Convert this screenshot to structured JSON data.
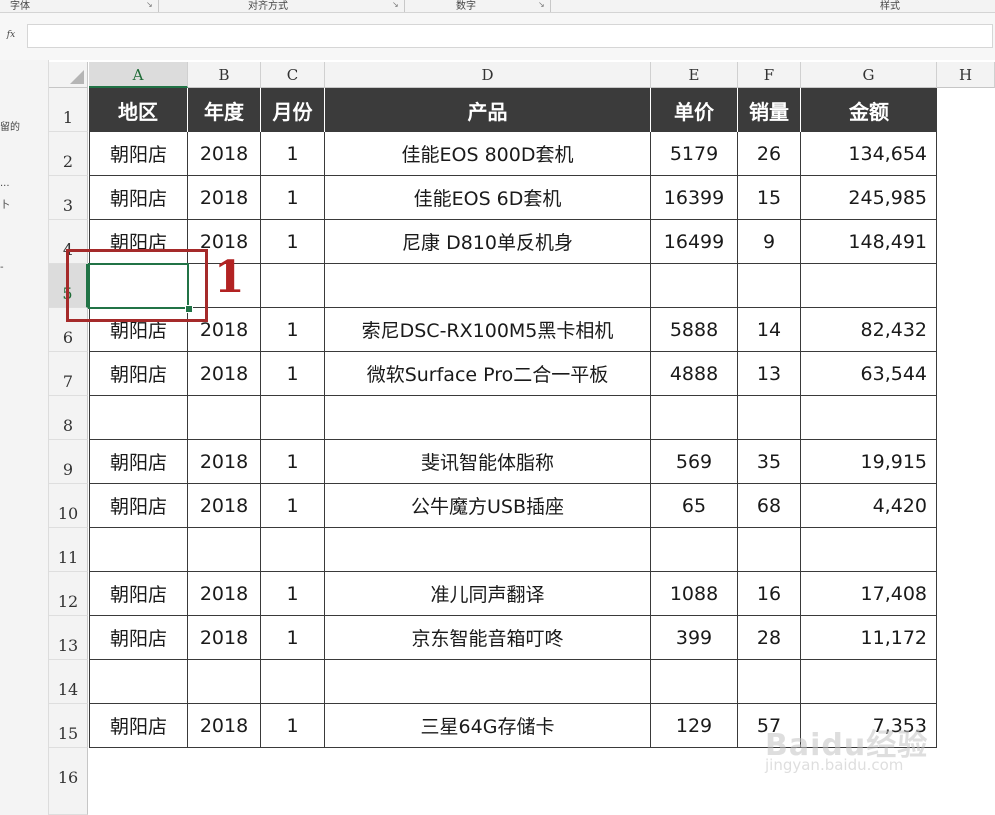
{
  "ribbon": {
    "groups": [
      {
        "label": "字体"
      },
      {
        "label": "对齐方式"
      },
      {
        "label": "数字"
      },
      {
        "label": "样式"
      }
    ]
  },
  "formula_bar": {
    "fx_label": "fx",
    "value": ""
  },
  "left_pane": {
    "texts": [
      "留的",
      "...",
      "卜",
      "-"
    ]
  },
  "columns": [
    "A",
    "B",
    "C",
    "D",
    "E",
    "F",
    "G",
    "H"
  ],
  "active_column": "A",
  "rows": [
    "1",
    "2",
    "3",
    "4",
    "5",
    "6",
    "7",
    "8",
    "9",
    "10",
    "11",
    "12",
    "13",
    "14",
    "15",
    "16"
  ],
  "active_row": "5",
  "table": {
    "headers": [
      "地区",
      "年度",
      "月份",
      "产品",
      "单价",
      "销量",
      "金额"
    ],
    "rows": [
      [
        "朝阳店",
        "2018",
        "1",
        "佳能EOS 800D套机",
        "5179",
        "26",
        "134,654"
      ],
      [
        "朝阳店",
        "2018",
        "1",
        "佳能EOS 6D套机",
        "16399",
        "15",
        "245,985"
      ],
      [
        "朝阳店",
        "2018",
        "1",
        "尼康 D810单反机身",
        "16499",
        "9",
        "148,491"
      ],
      [
        "",
        "",
        "",
        "",
        "",
        "",
        ""
      ],
      [
        "朝阳店",
        "2018",
        "1",
        "索尼DSC-RX100M5黑卡相机",
        "5888",
        "14",
        "82,432"
      ],
      [
        "朝阳店",
        "2018",
        "1",
        "微软Surface Pro二合一平板",
        "4888",
        "13",
        "63,544"
      ],
      [
        "",
        "",
        "",
        "",
        "",
        "",
        ""
      ],
      [
        "朝阳店",
        "2018",
        "1",
        "斐讯智能体脂称",
        "569",
        "35",
        "19,915"
      ],
      [
        "朝阳店",
        "2018",
        "1",
        "公牛魔方USB插座",
        "65",
        "68",
        "4,420"
      ],
      [
        "",
        "",
        "",
        "",
        "",
        "",
        ""
      ],
      [
        "朝阳店",
        "2018",
        "1",
        "准儿同声翻译",
        "1088",
        "16",
        "17,408"
      ],
      [
        "朝阳店",
        "2018",
        "1",
        "京东智能音箱叮咚",
        "399",
        "28",
        "11,172"
      ],
      [
        "",
        "",
        "",
        "",
        "",
        "",
        ""
      ],
      [
        "朝阳店",
        "2018",
        "1",
        "三星64G存储卡",
        "129",
        "57",
        "7,353"
      ]
    ]
  },
  "annotation": {
    "number": "1"
  },
  "watermark": {
    "brand": "Baidu经验",
    "url": "jingyan.baidu.com"
  },
  "colors": {
    "header_bg": "#3b3b3b",
    "accent": "#217346",
    "annotation": "#b22222"
  }
}
